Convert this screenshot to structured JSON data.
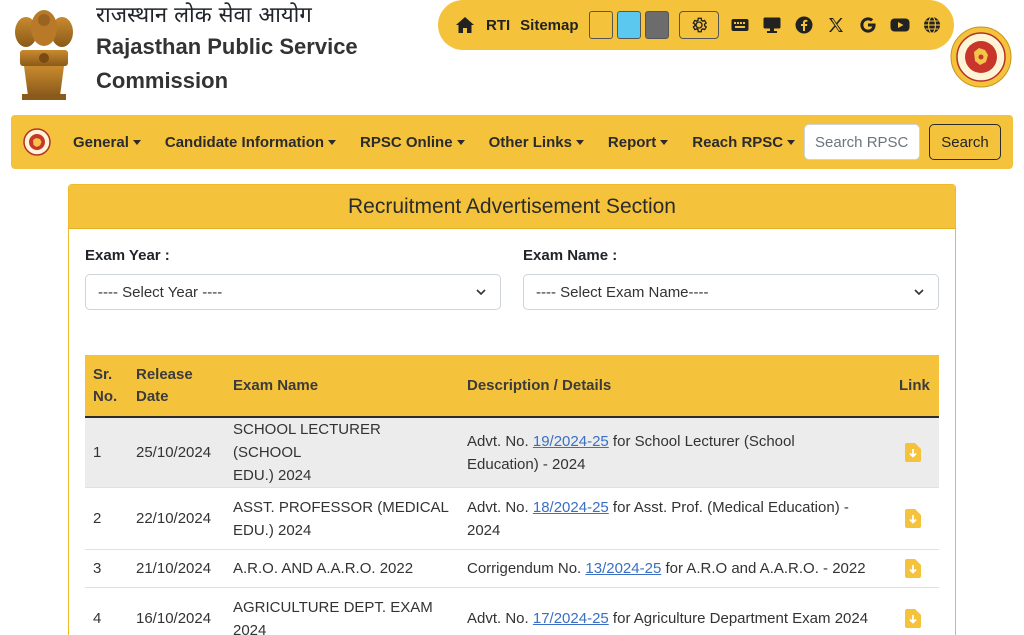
{
  "header": {
    "title_hindi": "राजस्थान लोक सेवा आयोग",
    "title_english_line1": "Rajasthan Public Service",
    "title_english_line2": "Commission"
  },
  "topbar": {
    "rti_label": "RTI",
    "sitemap_label": "Sitemap",
    "swatches": [
      "#f5c33b",
      "#5bc8f0",
      "#6c6c6c"
    ],
    "icons": [
      "home-icon",
      "gear-icon",
      "keyboard-icon",
      "monitor-icon",
      "facebook-icon",
      "x-icon",
      "google-icon",
      "youtube-icon",
      "globe-icon"
    ]
  },
  "nav": {
    "items": [
      "General",
      "Candidate Information",
      "RPSC Online",
      "Other Links",
      "Report",
      "Reach RPSC"
    ],
    "search_placeholder": "Search RPSC",
    "search_button": "Search"
  },
  "section": {
    "title": "Recruitment Advertisement Section",
    "exam_year_label": "Exam Year :",
    "exam_year_value": "---- Select Year ----",
    "exam_name_label": "Exam Name :",
    "exam_name_value": "---- Select Exam Name----"
  },
  "table": {
    "headers": {
      "sr_line1": "Sr.",
      "sr_line2": "No.",
      "release_line1": "Release",
      "release_line2": "Date",
      "exam_name": "Exam Name",
      "description": "Description / Details",
      "link": "Link"
    },
    "rows": [
      {
        "sr": "1",
        "date": "25/10/2024",
        "exam_l1": "SCHOOL LECTURER (SCHOOL",
        "exam_l2": "EDU.) 2024",
        "desc_pre": "Advt. No. ",
        "desc_link": "19/2024-25",
        "desc_post_l1": " for School Lecturer (School",
        "desc_post_l2": "Education) - 2024"
      },
      {
        "sr": "2",
        "date": "22/10/2024",
        "exam_l1": "ASST. PROFESSOR (MEDICAL",
        "exam_l2": "EDU.) 2024",
        "desc_pre": "Advt. No. ",
        "desc_link": "18/2024-25",
        "desc_post_l1": " for Asst. Prof. (Medical Education) -",
        "desc_post_l2": "2024"
      },
      {
        "sr": "3",
        "date": "21/10/2024",
        "exam_l1": "A.R.O. AND A.A.R.O. 2022",
        "exam_l2": "",
        "desc_pre": "Corrigendum No. ",
        "desc_link": "13/2024-25",
        "desc_post_l1": " for A.R.O and A.A.R.O. - 2022",
        "desc_post_l2": ""
      },
      {
        "sr": "4",
        "date": "16/10/2024",
        "exam_l1": "AGRICULTURE DEPT. EXAM",
        "exam_l2": "2024",
        "desc_pre": "Advt. No. ",
        "desc_link": "17/2024-25",
        "desc_post_l1": " for Agriculture Department Exam 2024",
        "desc_post_l2": ""
      }
    ]
  }
}
